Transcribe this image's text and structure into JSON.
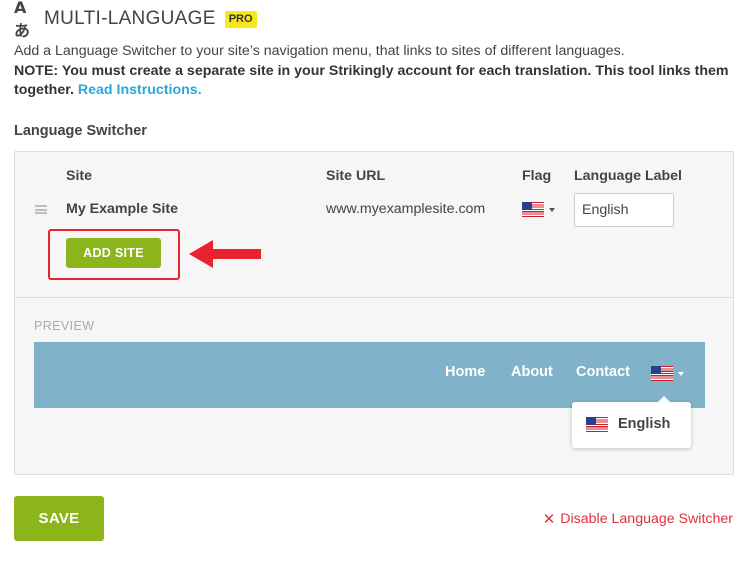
{
  "header": {
    "icon": "translate-icon",
    "icon_glyph": "Aあ",
    "title": "MULTI-LANGUAGE",
    "badge": "PRO",
    "badge_color": "#f6e71f"
  },
  "intro": {
    "description": "Add a Language Switcher to your site’s navigation menu, that links to sites of different languages.",
    "note": "NOTE: You must create a separate site in your Strikingly account for each translation. This tool links them together.",
    "link_label": "Read Instructions.",
    "link_color": "#29a8d9"
  },
  "section_label": "Language Switcher",
  "table": {
    "columns": [
      "Site",
      "Site URL",
      "Flag",
      "Language Label"
    ],
    "rows": [
      {
        "site": "My Example Site",
        "url": "www.myexamplesite.com",
        "flag": "us-flag-icon",
        "language_label": "English"
      }
    ]
  },
  "add_site_label": "ADD SITE",
  "annotation": {
    "highlight_color": "#e8232d",
    "arrow": "left-arrow-icon"
  },
  "preview": {
    "label": "PREVIEW",
    "bar_color": "#80b3ca",
    "nav": [
      "Home",
      "About",
      "Contact"
    ],
    "dropdown_label": "English"
  },
  "footer": {
    "save_label": "SAVE",
    "accent": "#8cb51c",
    "disable_label": "Disable Language Switcher",
    "disable_color": "#e0323e"
  }
}
